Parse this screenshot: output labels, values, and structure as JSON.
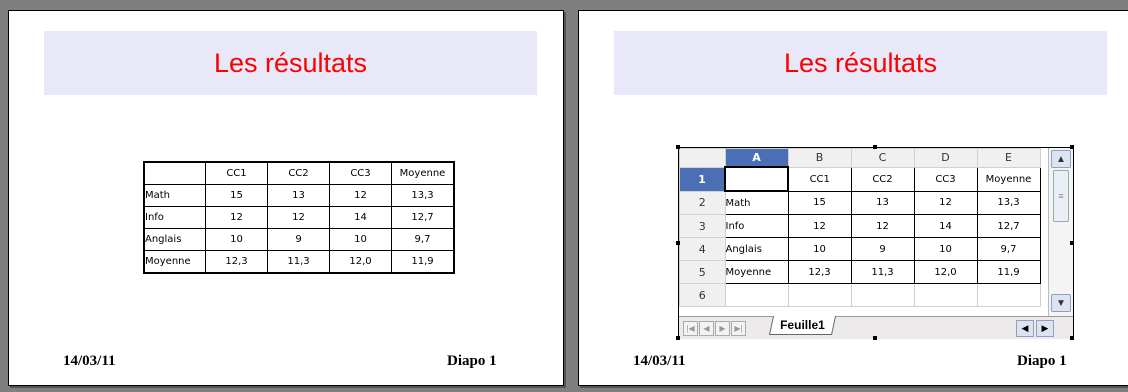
{
  "slides": [
    {
      "title": "Les résultats",
      "date": "14/03/11",
      "slide_label": "Diapo 1"
    },
    {
      "title": "Les résultats",
      "date": "14/03/11",
      "slide_label": "Diapo 1"
    }
  ],
  "table": {
    "headers": [
      "",
      "CC1",
      "CC2",
      "CC3",
      "Moyenne"
    ],
    "rows": [
      [
        "Math",
        "15",
        "13",
        "12",
        "13,3"
      ],
      [
        "Info",
        "12",
        "12",
        "14",
        "12,7"
      ],
      [
        "Anglais",
        "10",
        "9",
        "10",
        "9,7"
      ],
      [
        "Moyenne",
        "12,3",
        "11,3",
        "12,0",
        "11,9"
      ]
    ]
  },
  "spreadsheet": {
    "columns": [
      "A",
      "B",
      "C",
      "D",
      "E"
    ],
    "row_numbers": [
      "1",
      "2",
      "3",
      "4",
      "5",
      "6"
    ],
    "sheet_tab": "Feuille1",
    "icons": {
      "scroll_up": "chevron-up-icon",
      "scroll_down": "chevron-down-icon",
      "thumb": "grip-icon"
    }
  }
}
